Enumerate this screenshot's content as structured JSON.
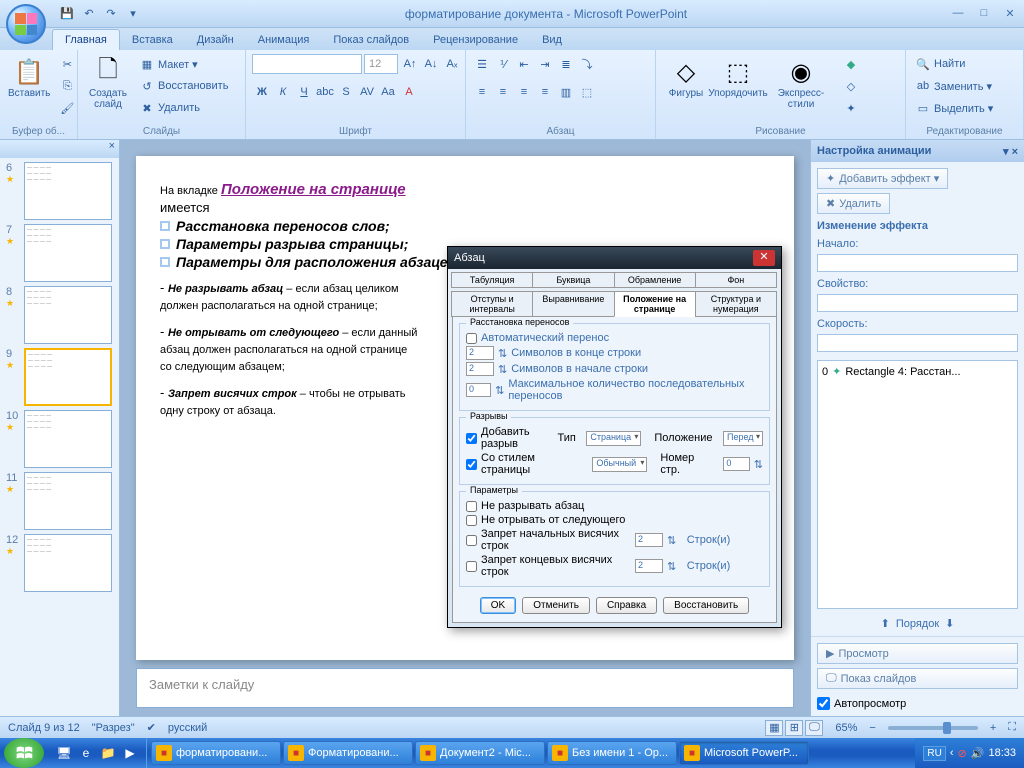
{
  "title": "форматирование документа - Microsoft PowerPoint",
  "qat": {
    "save": "💾",
    "undo": "↶",
    "redo": "↷",
    "more": "▾"
  },
  "tabs": [
    "Главная",
    "Вставка",
    "Дизайн",
    "Анимация",
    "Показ слайдов",
    "Рецензирование",
    "Вид"
  ],
  "active_tab": 0,
  "ribbon": {
    "clipboard": {
      "label": "Буфер об...",
      "paste": "Вставить"
    },
    "slides": {
      "label": "Слайды",
      "new": "Создать\nслайд",
      "layout": "Макет ▾",
      "reset": "Восстановить",
      "delete": "Удалить"
    },
    "font": {
      "label": "Шрифт",
      "size": "12"
    },
    "paragraph": {
      "label": "Абзац"
    },
    "drawing": {
      "label": "Рисование",
      "shapes": "Фигуры",
      "arrange": "Упорядочить",
      "quick": "Экспресс-стили"
    },
    "editing": {
      "label": "Редактирование",
      "find": "Найти",
      "replace": "Заменить ▾",
      "select": "Выделить ▾"
    }
  },
  "thumbs": [
    {
      "n": "6"
    },
    {
      "n": "7"
    },
    {
      "n": "8"
    },
    {
      "n": "9",
      "sel": true
    },
    {
      "n": "10"
    },
    {
      "n": "11"
    },
    {
      "n": "12"
    }
  ],
  "slide": {
    "tag": "0",
    "intro_pre": "На вкладке  ",
    "intro_tab": "Положение на странице",
    "intro_post": "имеется",
    "b1": "Расстановка переносов слов;",
    "b2": "Параметры разрыва страницы;",
    "b3": "Параметры для расположения абзацев",
    "p1_b": "Не  разрывать абзац",
    "p1_r": " – если абзац целиком должен располагаться на одной странице;",
    "p2_b": "Не отрывать от следующего",
    "p2_r": " – если  данный абзац должен располагаться на одной странице со следующим абзацем;",
    "p3_b": "Запрет висячих строк",
    "p3_r": " – чтобы не отрывать одну строку от абзаца."
  },
  "dlg": {
    "title": "Абзац",
    "tabs_top": [
      "Табуляция",
      "Буквица",
      "Обрамление",
      "Фон"
    ],
    "tabs_bot": [
      "Отступы и интервалы",
      "Выравнивание",
      "Положение на странице",
      "Структура и нумерация"
    ],
    "active": "Положение на странице",
    "g1": "Расстановка переносов",
    "g1_chk": "Автоматический перенос",
    "g1_r1": "Символов в конце строки",
    "g1_r2": "Символов в начале строки",
    "g1_r3": "Максимальное количество последовательных переносов",
    "g1_v": "2",
    "g1_v3": "0",
    "g2": "Разрывы",
    "g2_add": "Добавить разрыв",
    "g2_type": "Тип",
    "g2_type_v": "Страница",
    "g2_pos": "Положение",
    "g2_pos_v": "Перед",
    "g2_style": "Со стилем страницы",
    "g2_style_v": "Обычный",
    "g2_num": "Номер стр.",
    "g2_num_v": "0",
    "g3": "Параметры",
    "g3_1": "Не разрывать абзац",
    "g3_2": "Не отрывать от следующего",
    "g3_3": "Запрет начальных висячих строк",
    "g3_3v": "2",
    "g3_3u": "Строк(и)",
    "g3_4": "Запрет концевых висячих строк",
    "g3_4v": "2",
    "g3_4u": "Строк(и)",
    "ok": "OK",
    "cancel": "Отменить",
    "help": "Справка",
    "restore": "Восстановить"
  },
  "notes": "Заметки к слайду",
  "anim": {
    "title": "Настройка анимации",
    "add": "Добавить эффект ▾",
    "del": "Удалить",
    "change": "Изменение эффекта",
    "start": "Начало:",
    "prop": "Свойство:",
    "speed": "Скорость:",
    "item_n": "0",
    "item": "Rectangle 4:  Расстан...",
    "order": "Порядок",
    "preview": "Просмотр",
    "slideshow": "Показ слайдов",
    "auto": "Автопросмотр"
  },
  "status": {
    "slide": "Слайд 9 из 12",
    "theme": "\"Разрез\"",
    "lang": "русский",
    "zoom": "65%"
  },
  "taskbar": {
    "items": [
      {
        "l": "форматировани...",
        "a": false
      },
      {
        "l": "Форматировани...",
        "a": false
      },
      {
        "l": "Документ2 - Mic...",
        "a": false
      },
      {
        "l": "Без имени 1 - Op...",
        "a": false
      },
      {
        "l": "Microsoft PowerP...",
        "a": true
      }
    ],
    "lang": "RU",
    "time": "18:33"
  }
}
